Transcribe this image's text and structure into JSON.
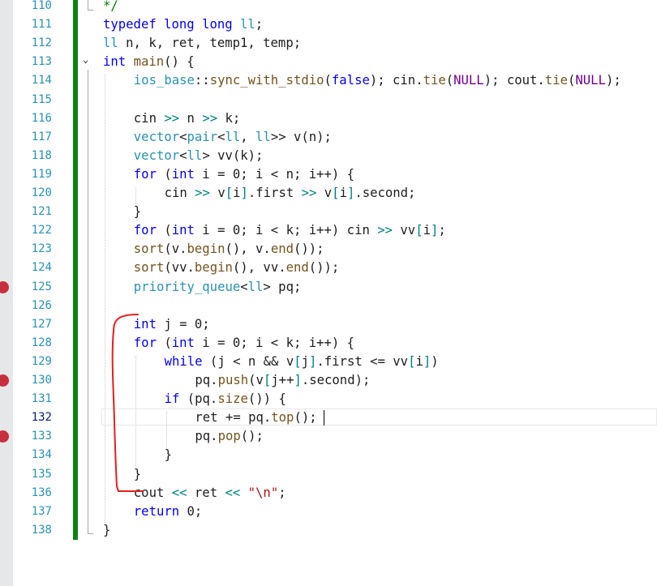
{
  "editor": {
    "active_line": 132,
    "line_numbers": [
      "110",
      "111",
      "112",
      "113",
      "114",
      "115",
      "116",
      "117",
      "118",
      "119",
      "120",
      "121",
      "122",
      "123",
      "124",
      "125",
      "126",
      "127",
      "128",
      "129",
      "130",
      "131",
      "132",
      "133",
      "134",
      "135",
      "136",
      "137",
      "138"
    ],
    "breakpoint_lines": [
      125,
      130,
      133
    ],
    "code_lines": [
      {
        "n": 110,
        "indent": 0,
        "tokens": [
          {
            "t": "*/",
            "c": "cm"
          }
        ]
      },
      {
        "n": 111,
        "indent": 0,
        "tokens": [
          {
            "t": "typedef",
            "c": "kw"
          },
          {
            "t": " "
          },
          {
            "t": "long",
            "c": "kw"
          },
          {
            "t": " "
          },
          {
            "t": "long",
            "c": "kw"
          },
          {
            "t": " "
          },
          {
            "t": "ll",
            "c": "ty"
          },
          {
            "t": ";"
          }
        ]
      },
      {
        "n": 112,
        "indent": 0,
        "tokens": [
          {
            "t": "ll",
            "c": "ty"
          },
          {
            "t": " n, k, ret, temp1, temp;"
          }
        ]
      },
      {
        "n": 113,
        "indent": 0,
        "tokens": [
          {
            "t": "int",
            "c": "kw"
          },
          {
            "t": " "
          },
          {
            "t": "main",
            "c": "fn"
          },
          {
            "t": "() {"
          }
        ]
      },
      {
        "n": 114,
        "indent": 1,
        "tokens": [
          {
            "t": "ios_base",
            "c": "ty"
          },
          {
            "t": "::"
          },
          {
            "t": "sync_with_stdio",
            "c": "fn"
          },
          {
            "t": "("
          },
          {
            "t": "false",
            "c": "kw"
          },
          {
            "t": "); cin."
          },
          {
            "t": "tie",
            "c": "fn"
          },
          {
            "t": "("
          },
          {
            "t": "NULL",
            "c": "mac"
          },
          {
            "t": "); cout."
          },
          {
            "t": "tie",
            "c": "fn"
          },
          {
            "t": "("
          },
          {
            "t": "NULL",
            "c": "mac"
          },
          {
            "t": ");"
          }
        ]
      },
      {
        "n": 115,
        "indent": 0,
        "tokens": []
      },
      {
        "n": 116,
        "indent": 1,
        "tokens": [
          {
            "t": "cin "
          },
          {
            "t": ">>",
            "c": "op"
          },
          {
            "t": " n "
          },
          {
            "t": ">>",
            "c": "op"
          },
          {
            "t": " k;"
          }
        ]
      },
      {
        "n": 117,
        "indent": 1,
        "tokens": [
          {
            "t": "vector",
            "c": "ty"
          },
          {
            "t": "<"
          },
          {
            "t": "pair",
            "c": "ty"
          },
          {
            "t": "<"
          },
          {
            "t": "ll",
            "c": "ty"
          },
          {
            "t": ", "
          },
          {
            "t": "ll",
            "c": "ty"
          },
          {
            "t": ">> v(n);"
          }
        ]
      },
      {
        "n": 118,
        "indent": 1,
        "tokens": [
          {
            "t": "vector",
            "c": "ty"
          },
          {
            "t": "<"
          },
          {
            "t": "ll",
            "c": "ty"
          },
          {
            "t": "> vv(k);"
          }
        ]
      },
      {
        "n": 119,
        "indent": 1,
        "tokens": [
          {
            "t": "for",
            "c": "kw"
          },
          {
            "t": " ("
          },
          {
            "t": "int",
            "c": "kw"
          },
          {
            "t": " i = 0; i < n; i++) {"
          }
        ]
      },
      {
        "n": 120,
        "indent": 2,
        "tokens": [
          {
            "t": "cin "
          },
          {
            "t": ">>",
            "c": "op"
          },
          {
            "t": " v"
          },
          {
            "t": "[",
            "c": "op"
          },
          {
            "t": "i"
          },
          {
            "t": "]",
            "c": "op"
          },
          {
            "t": ".first "
          },
          {
            "t": ">>",
            "c": "op"
          },
          {
            "t": " v"
          },
          {
            "t": "[",
            "c": "op"
          },
          {
            "t": "i"
          },
          {
            "t": "]",
            "c": "op"
          },
          {
            "t": ".second;"
          }
        ]
      },
      {
        "n": 121,
        "indent": 1,
        "tokens": [
          {
            "t": "}"
          }
        ]
      },
      {
        "n": 122,
        "indent": 1,
        "tokens": [
          {
            "t": "for",
            "c": "kw"
          },
          {
            "t": " ("
          },
          {
            "t": "int",
            "c": "kw"
          },
          {
            "t": " i = 0; i < k; i++) cin "
          },
          {
            "t": ">>",
            "c": "op"
          },
          {
            "t": " vv"
          },
          {
            "t": "[",
            "c": "op"
          },
          {
            "t": "i"
          },
          {
            "t": "]",
            "c": "op"
          },
          {
            "t": ";"
          }
        ]
      },
      {
        "n": 123,
        "indent": 1,
        "tokens": [
          {
            "t": "sort",
            "c": "fn"
          },
          {
            "t": "(v."
          },
          {
            "t": "begin",
            "c": "fn"
          },
          {
            "t": "(), v."
          },
          {
            "t": "end",
            "c": "fn"
          },
          {
            "t": "());"
          }
        ]
      },
      {
        "n": 124,
        "indent": 1,
        "tokens": [
          {
            "t": "sort",
            "c": "fn"
          },
          {
            "t": "(vv."
          },
          {
            "t": "begin",
            "c": "fn"
          },
          {
            "t": "(), vv."
          },
          {
            "t": "end",
            "c": "fn"
          },
          {
            "t": "());"
          }
        ]
      },
      {
        "n": 125,
        "indent": 1,
        "tokens": [
          {
            "t": "priority_queue",
            "c": "ty"
          },
          {
            "t": "<"
          },
          {
            "t": "ll",
            "c": "ty"
          },
          {
            "t": "> pq;"
          }
        ]
      },
      {
        "n": 126,
        "indent": 0,
        "tokens": []
      },
      {
        "n": 127,
        "indent": 1,
        "tokens": [
          {
            "t": "int",
            "c": "kw"
          },
          {
            "t": " j = 0;"
          }
        ]
      },
      {
        "n": 128,
        "indent": 1,
        "tokens": [
          {
            "t": "for",
            "c": "kw"
          },
          {
            "t": " ("
          },
          {
            "t": "int",
            "c": "kw"
          },
          {
            "t": " i = 0; i < k; i++) {"
          }
        ]
      },
      {
        "n": 129,
        "indent": 2,
        "tokens": [
          {
            "t": "while",
            "c": "kw"
          },
          {
            "t": " (j < n && v"
          },
          {
            "t": "[",
            "c": "op"
          },
          {
            "t": "j"
          },
          {
            "t": "]",
            "c": "op"
          },
          {
            "t": ".first <= vv"
          },
          {
            "t": "[",
            "c": "op"
          },
          {
            "t": "i"
          },
          {
            "t": "]",
            "c": "op"
          },
          {
            "t": ")"
          }
        ]
      },
      {
        "n": 130,
        "indent": 3,
        "tokens": [
          {
            "t": "pq."
          },
          {
            "t": "push",
            "c": "fn"
          },
          {
            "t": "(v"
          },
          {
            "t": "[",
            "c": "op"
          },
          {
            "t": "j++"
          },
          {
            "t": "]",
            "c": "op"
          },
          {
            "t": ".second);"
          }
        ]
      },
      {
        "n": 131,
        "indent": 2,
        "tokens": [
          {
            "t": "if",
            "c": "kw"
          },
          {
            "t": " (pq."
          },
          {
            "t": "size",
            "c": "fn"
          },
          {
            "t": "()) {"
          }
        ]
      },
      {
        "n": 132,
        "indent": 3,
        "tokens": [
          {
            "t": "ret += pq."
          },
          {
            "t": "top",
            "c": "fn"
          },
          {
            "t": "();"
          }
        ]
      },
      {
        "n": 133,
        "indent": 3,
        "tokens": [
          {
            "t": "pq."
          },
          {
            "t": "pop",
            "c": "fn"
          },
          {
            "t": "();"
          }
        ]
      },
      {
        "n": 134,
        "indent": 2,
        "tokens": [
          {
            "t": "}"
          }
        ]
      },
      {
        "n": 135,
        "indent": 1,
        "tokens": [
          {
            "t": "}"
          }
        ]
      },
      {
        "n": 136,
        "indent": 1,
        "tokens": [
          {
            "t": "cout "
          },
          {
            "t": "<<",
            "c": "op"
          },
          {
            "t": " ret "
          },
          {
            "t": "<<",
            "c": "op"
          },
          {
            "t": " "
          },
          {
            "t": "\"\\n\"",
            "c": "str"
          },
          {
            "t": ";"
          }
        ]
      },
      {
        "n": 137,
        "indent": 1,
        "tokens": [
          {
            "t": "return",
            "c": "kw"
          },
          {
            "t": " 0;"
          }
        ]
      },
      {
        "n": 138,
        "indent": 0,
        "tokens": [
          {
            "t": "}"
          }
        ]
      }
    ]
  },
  "colors": {
    "keyword": "#0000ff",
    "type": "#2b91af",
    "function": "#74531f",
    "macro": "#6f008a",
    "string": "#a31515",
    "operator": "#008080",
    "breakpoint": "#c6303e",
    "change_bar": "#108010",
    "annotation_stroke": "#e02020"
  },
  "icons": {
    "fold": "chevron-down-icon",
    "breakpoint": "breakpoint-icon"
  }
}
